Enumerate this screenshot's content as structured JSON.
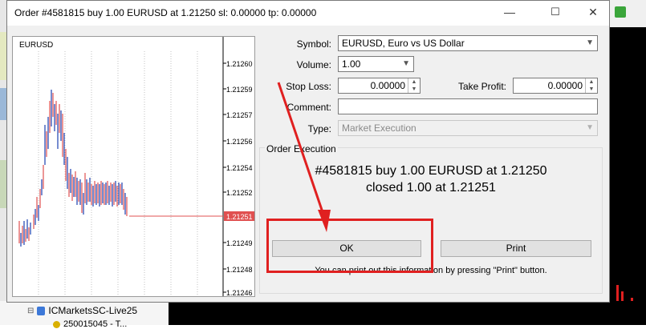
{
  "window": {
    "title": "Order #4581815 buy 1.00 EURUSD at 1.21250 sl: 0.00000 tp: 0.00000"
  },
  "chart": {
    "symbol": "EURUSD",
    "current_price": "1.21251",
    "price_labels": [
      "1.21260",
      "1.21259",
      "1.21257",
      "1.21256",
      "1.21254",
      "1.21252",
      "1.21251",
      "1.21249",
      "1.21248",
      "1.21246"
    ]
  },
  "form": {
    "symbol_label": "Symbol:",
    "symbol_value": "EURUSD, Euro vs US Dollar",
    "volume_label": "Volume:",
    "volume_value": "1.00",
    "stop_loss_label": "Stop Loss:",
    "stop_loss_value": "0.00000",
    "take_profit_label": "Take Profit:",
    "take_profit_value": "0.00000",
    "comment_label": "Comment:",
    "comment_value": "",
    "type_label": "Type:",
    "type_value": "Market Execution"
  },
  "execution": {
    "group_label": "Order Execution",
    "line1": "#4581815 buy 1.00 EURUSD at 1.21250",
    "line2": "closed 1.00 at 1.21251",
    "ok_label": "OK",
    "print_label": "Print",
    "note": "You can print out this information by pressing \"Print\" button."
  },
  "background": {
    "tree_item": "ICMarketsSC-Live25",
    "tree_subitem": "250015045 - T..."
  },
  "colors": {
    "highlight": "#e02020",
    "bid_line": "#e05050",
    "tick_up": "#1a3fb0",
    "tick_down": "#e05050"
  },
  "icons": [
    "minimize-icon",
    "maximize-icon",
    "close-icon",
    "chevron-down-icon",
    "spin-up-icon",
    "spin-down-icon",
    "server-icon",
    "account-icon"
  ]
}
